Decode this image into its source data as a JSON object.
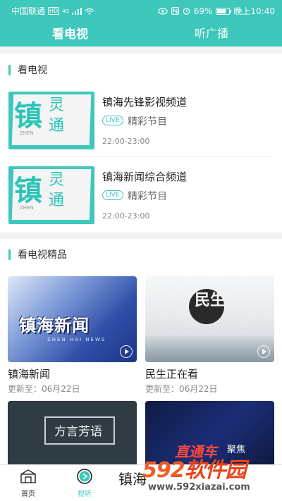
{
  "status_bar": {
    "carrier": "中国联通",
    "hd": "HD",
    "signal": "4G",
    "battery": "69%",
    "time": "晚上10:40"
  },
  "tabs": [
    {
      "label": "看电视",
      "active": true
    },
    {
      "label": "听广播",
      "active": false
    }
  ],
  "tv_section": {
    "title": "看电视",
    "channels": [
      {
        "name": "镇海先锋影视频道",
        "live": "LIVE",
        "program": "精彩节目",
        "time": "22:00-23:00",
        "thumb": {
          "c1": "镇",
          "c2": "灵",
          "c3": "通",
          "c4": "ZHEN"
        }
      },
      {
        "name": "镇海新闻综合频道",
        "live": "LIVE",
        "program": "精彩节目",
        "time": "22:00-23:00",
        "thumb": {
          "c1": "镇",
          "c2": "灵",
          "c3": "通",
          "c4": "ZHEN"
        }
      }
    ]
  },
  "featured_section": {
    "title": "看电视精品",
    "items": [
      {
        "title": "镇海新闻",
        "updated": "更新至：06月22日",
        "img_text": "镇海新闻",
        "img_sub": "ZHEN HAI NEWS"
      },
      {
        "title": "民生正在看",
        "updated": "更新至：06月22日",
        "img_text": "民生"
      },
      {
        "img_text": "方言芳语"
      },
      {
        "img_text": "直通车",
        "img_text2": "聚焦"
      }
    ]
  },
  "bottom_nav": [
    {
      "label": "首页",
      "icon": "home-icon"
    },
    {
      "label": "视听",
      "icon": "play-circle-icon",
      "active": true
    },
    {
      "label": "",
      "icon": "logo",
      "text": "镇海"
    }
  ],
  "watermark": {
    "brand_num": "592",
    "brand_cn": "软件园",
    "url": "www.592xiazai.com"
  },
  "colors": {
    "accent": "#3ec7bb",
    "watermark": "#f25a23"
  }
}
